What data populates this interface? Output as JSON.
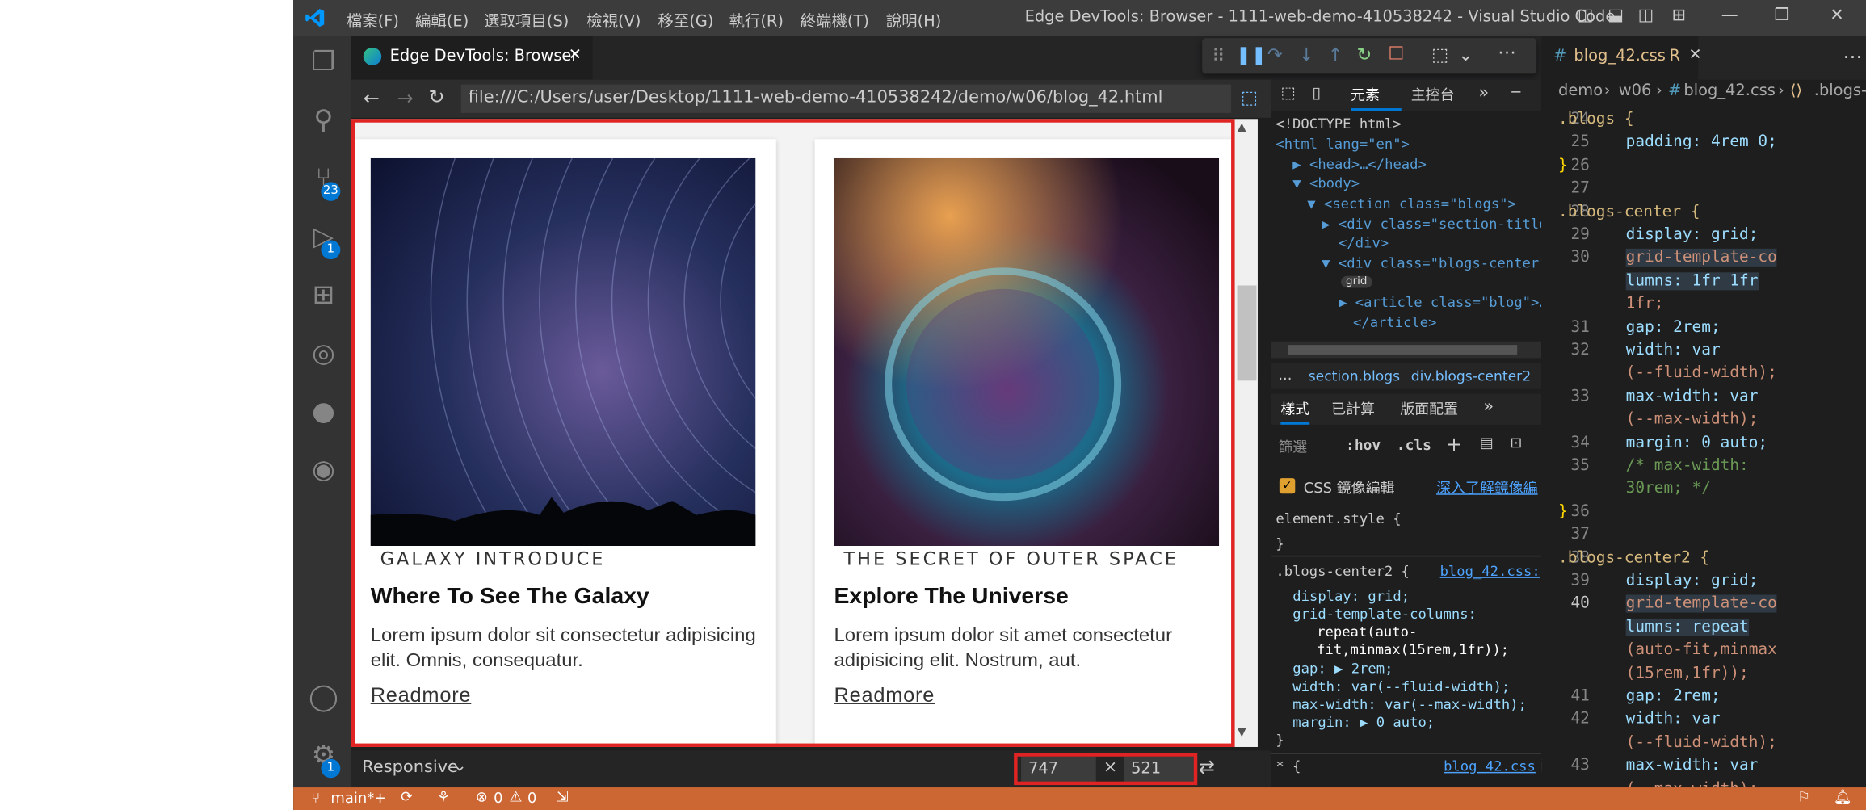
{
  "window": {
    "title": "Edge DevTools: Browser - 1111-web-demo-410538242 - Visual Studio Code",
    "menu": [
      "檔案(F)",
      "編輯(E)",
      "選取項目(S)",
      "檢視(V)",
      "移至(G)",
      "執行(R)",
      "終端機(T)",
      "說明(H)"
    ]
  },
  "activity_bar": {
    "source_control_badge": "23",
    "run_debug_badge": "1",
    "settings_badge": "1"
  },
  "devtools_tab": {
    "label": "Edge DevTools: Browser"
  },
  "address_bar": {
    "url": "file:///C:/Users/user/Desktop/1111-web-demo-410538242/demo/w06/blog_42.html"
  },
  "cards": [
    {
      "category": "GALAXY INTRODUCE",
      "title": "Where To See The Galaxy",
      "text": "Lorem ipsum dolor sit consectetur adipisicing elit. Omnis, consequatur.",
      "link": "Readmore"
    },
    {
      "category": "THE SECRET OF OUTER SPACE",
      "title": "Explore The Universe",
      "text": "Lorem ipsum dolor sit amet consectetur adipisicing elit. Nostrum, aut.",
      "link": "Readmore"
    }
  ],
  "browser_bottom": {
    "mode": "Responsive",
    "width": "747",
    "height": "521",
    "times": "×"
  },
  "devtools": {
    "tabs": [
      "元素",
      "主控台"
    ],
    "dom_lines": [
      "<!DOCTYPE html>",
      "<html lang=\"en\">",
      "<head>…</head>",
      "<body>",
      "<section class=\"blogs\">",
      "<div class=\"section-title",
      "</div>",
      "<div class=\"blogs-center\"",
      "grid",
      "<article class=\"blog\">…",
      "</article>"
    ],
    "breadcrumb": [
      "...",
      "section.blogs",
      "div.blogs-center2"
    ],
    "style_tabs": [
      "樣式",
      "已計算",
      "版面配置"
    ],
    "filter_placeholder": "篩選",
    "hov": ":hov",
    "cls": ".cls",
    "css_mirror_label": "CSS 鏡像編輯",
    "learn_more": "深入了解鏡像編",
    "element_style": "element.style {",
    "close_brace": "}",
    "rule_selector": ".blogs-center2 {",
    "rule_source": "blog_42.css:",
    "rule_lines": [
      "display: grid;",
      "grid-template-columns:",
      "repeat(auto-",
      "fit,minmax(15rem,1fr));",
      "gap: ▶ 2rem;",
      "width: var(--fluid-width);",
      "max-width: var(--max-width);",
      "margin: ▶ 0 auto;"
    ],
    "star_rule": "* {",
    "star_source": "blog_42.css"
  },
  "css_editor": {
    "tab_label": "blog_42.css",
    "tab_status": "R",
    "breadcrumb": [
      "demo",
      "w06",
      "blog_42.css",
      ".blogs-"
    ],
    "lines": [
      {
        "n": "24",
        "t": ".blogs {"
      },
      {
        "n": "25",
        "t": "padding: 4rem 0;"
      },
      {
        "n": "26",
        "t": "}"
      },
      {
        "n": "27",
        "t": ""
      },
      {
        "n": "28",
        "t": ".blogs-center {"
      },
      {
        "n": "29",
        "t": "display: grid;"
      },
      {
        "n": "30",
        "t": "grid-template-co"
      },
      {
        "n": "",
        "t": "lumns: 1fr 1fr"
      },
      {
        "n": "",
        "t": "1fr;"
      },
      {
        "n": "31",
        "t": "gap: 2rem;"
      },
      {
        "n": "32",
        "t": "width: var"
      },
      {
        "n": "",
        "t": "(--fluid-width);"
      },
      {
        "n": "33",
        "t": "max-width: var"
      },
      {
        "n": "",
        "t": "(--max-width);"
      },
      {
        "n": "34",
        "t": "margin: 0 auto;"
      },
      {
        "n": "35",
        "t": "/* max-width:"
      },
      {
        "n": "",
        "t": "30rem; */"
      },
      {
        "n": "36",
        "t": "}"
      },
      {
        "n": "37",
        "t": ""
      },
      {
        "n": "38",
        "t": ".blogs-center2 {"
      },
      {
        "n": "39",
        "t": "display: grid;"
      },
      {
        "n": "40",
        "t": "grid-template-co"
      },
      {
        "n": "",
        "t": "lumns: repeat"
      },
      {
        "n": "",
        "t": "(auto-fit,minmax"
      },
      {
        "n": "",
        "t": "(15rem,1fr));"
      },
      {
        "n": "41",
        "t": "gap: 2rem;"
      },
      {
        "n": "42",
        "t": "width: var"
      },
      {
        "n": "",
        "t": "(--fluid-width);"
      },
      {
        "n": "43",
        "t": "max-width: var"
      },
      {
        "n": "",
        "t": "(--max-width);"
      }
    ]
  },
  "status_bar": {
    "branch": "main*+",
    "errors": "0",
    "warnings": "0"
  },
  "colors": {
    "status_bar": "#cc6633",
    "highlight_border": "#e02424",
    "accent": "#0078d4"
  }
}
